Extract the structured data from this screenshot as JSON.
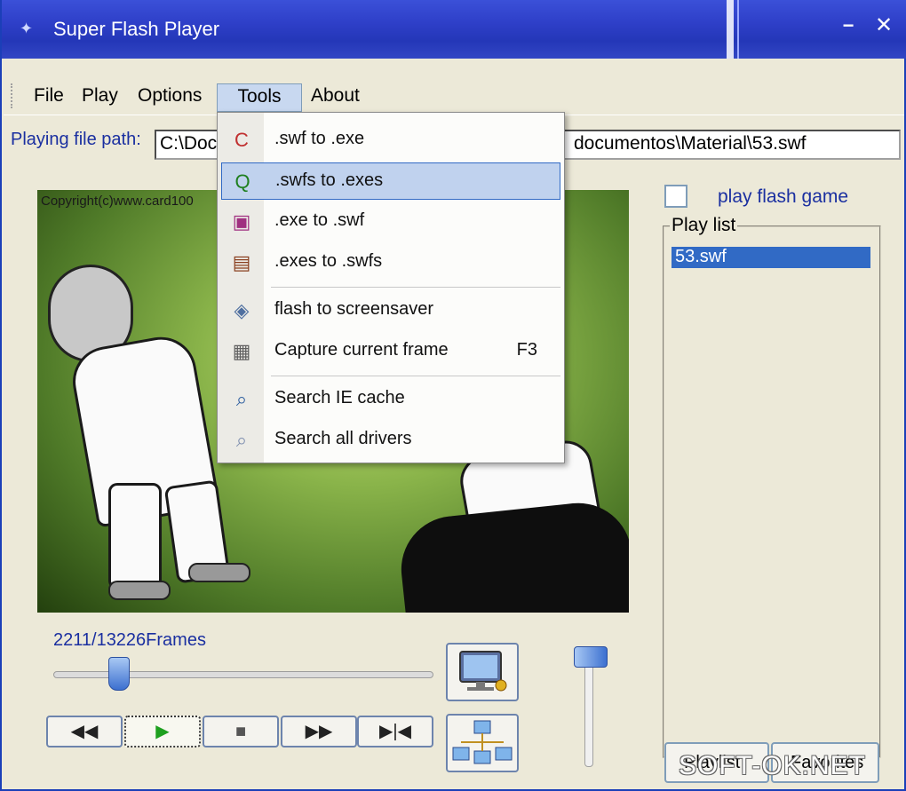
{
  "window": {
    "title": "Super Flash Player",
    "minimize_glyph": "−",
    "close_glyph": "✕"
  },
  "menubar": {
    "items": [
      "File",
      "Play",
      "Options",
      "Tools",
      "About"
    ],
    "active": "Tools"
  },
  "path": {
    "label": "Playing file path:",
    "value_left": "C:\\Doc",
    "value_right": "documentos\\Material\\53.swf"
  },
  "video": {
    "copyright": "Copyright(c)www.card100"
  },
  "side": {
    "play_flash_label": "play flash game",
    "play_flash_checked": false,
    "playlist_legend": "Play list",
    "playlist_items": [
      "53.swf"
    ],
    "playlist_button": "Playlist",
    "favorites_button": "Favorites"
  },
  "player": {
    "frames": "2211/13226Frames",
    "seek_fraction": 0.167
  },
  "transport": [
    {
      "name": "rewind",
      "glyph": "◀◀"
    },
    {
      "name": "play",
      "glyph": "▶"
    },
    {
      "name": "stop",
      "glyph": "■"
    },
    {
      "name": "fast-forward",
      "glyph": "▶▶"
    },
    {
      "name": "next-frame",
      "glyph": "▶|◀"
    }
  ],
  "dropdown": {
    "items": [
      {
        "label": ".swf to .exe",
        "icon": "swf-to-exe-icon",
        "glyph": "C",
        "hover": false
      },
      {
        "label": ".swfs to .exes",
        "icon": "swfs-to-exes-icon",
        "glyph": "Q",
        "hover": true
      },
      {
        "label": ".exe to .swf",
        "icon": "exe-to-swf-icon",
        "glyph": "▣",
        "hover": false
      },
      {
        "label": ".exes to .swfs",
        "icon": "exes-to-swfs-icon",
        "glyph": "▤",
        "hover": false
      },
      {
        "label": "flash to screensaver",
        "icon": "screensaver-icon",
        "glyph": "◈",
        "hover": false
      },
      {
        "label": "Capture current frame",
        "icon": "capture-icon",
        "glyph": "▦",
        "shortcut": "F3",
        "hover": false
      },
      {
        "label": "Search IE cache",
        "icon": "search-icon",
        "glyph": "⌕",
        "hover": false
      },
      {
        "label": "Search all drivers",
        "icon": "search-drivers-icon",
        "glyph": "⌕",
        "hover": false
      }
    ]
  },
  "watermark": "SOFT-OK.NET",
  "colors": {
    "title_bar": "#2e3fc8",
    "accent_blue": "#1a2fa0",
    "selection": "#316ac5",
    "menu_hover": "#c0d2ee"
  }
}
